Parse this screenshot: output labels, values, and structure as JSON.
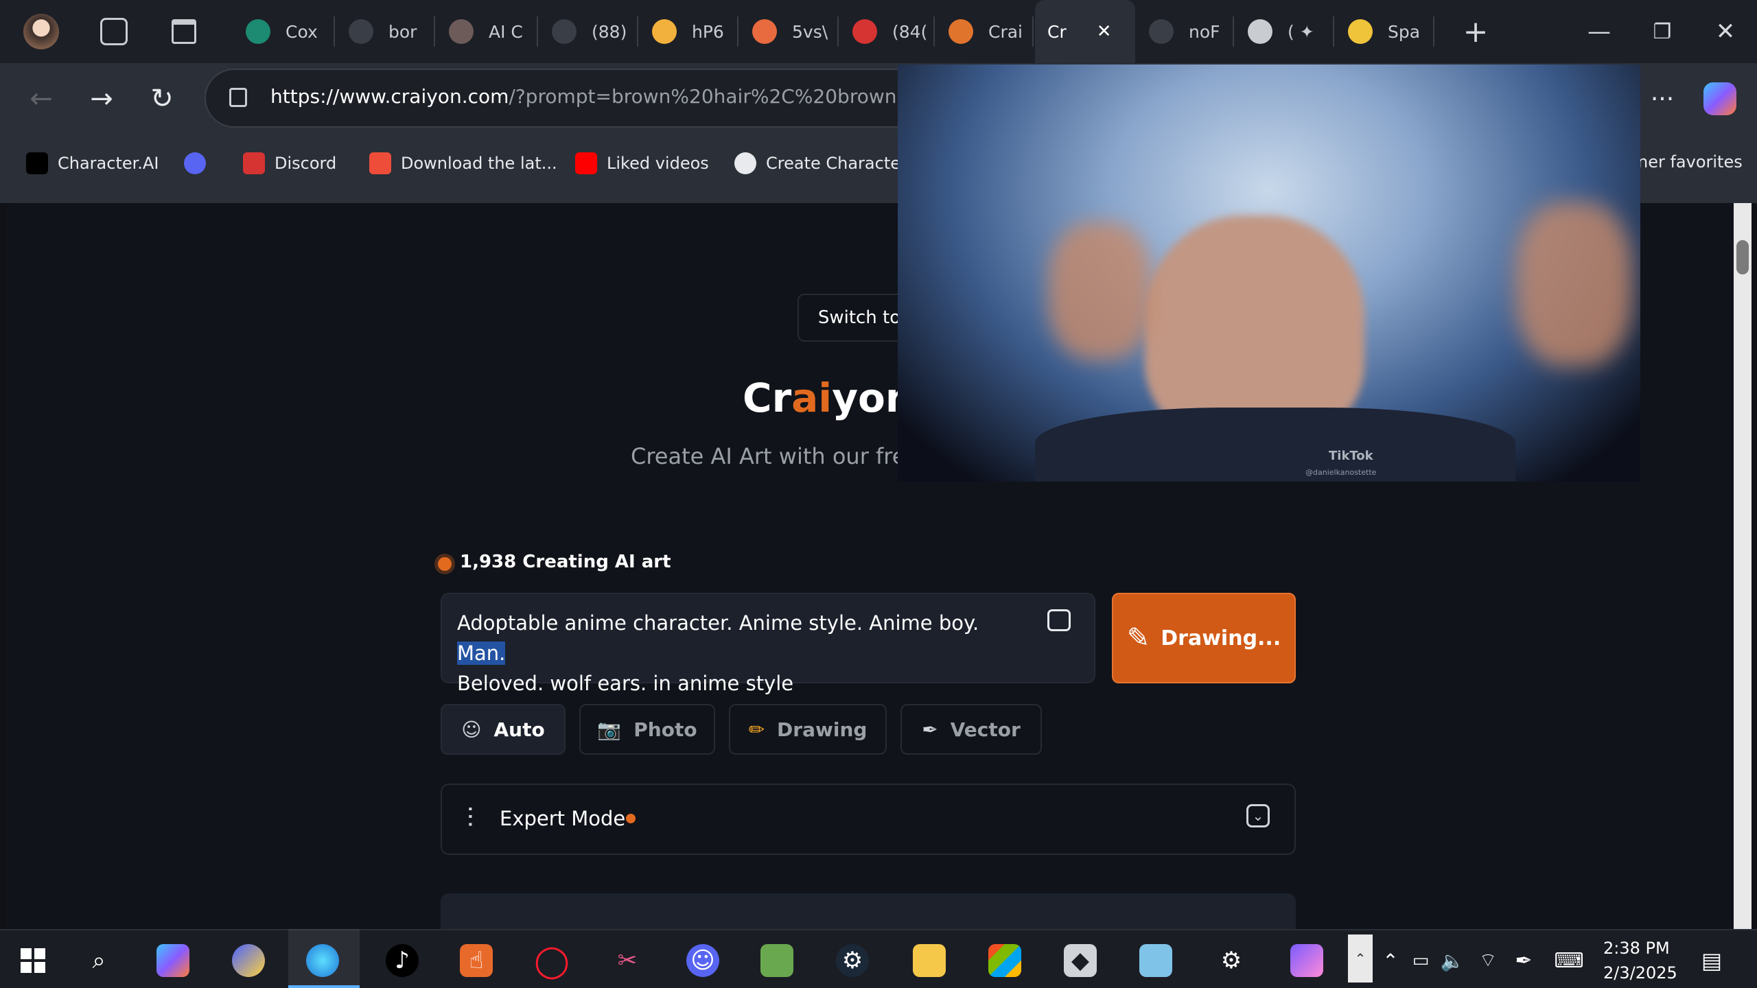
{
  "browser": {
    "tabs": [
      {
        "label": "Cox",
        "color": "#1d8a72"
      },
      {
        "label": "bor",
        "color": "#3a3e47"
      },
      {
        "label": "AI C",
        "color": "#6d5b5a"
      },
      {
        "label": "(88)",
        "color": "#3a3e47"
      },
      {
        "label": "hP6",
        "color": "#f2b13c"
      },
      {
        "label": "5vs\\",
        "color": "#e86a3f"
      },
      {
        "label": "(84(",
        "color": "#d63333"
      },
      {
        "label": "Crai",
        "color": "#e0742d"
      },
      {
        "label": "Cr",
        "color": "#2b2f38"
      },
      {
        "label": "noF",
        "color": "#3a3e47"
      },
      {
        "label": "( ✦",
        "color": "#c9ccd1"
      },
      {
        "label": "Spa",
        "color": "#f0c43a"
      }
    ],
    "url_host": "https://www.craiyon.com",
    "url_path": "/?prompt=brown%20hair%2C%20brown%20eyes",
    "bookmarks": [
      {
        "label": "Character.AI",
        "color": "#000000"
      },
      {
        "label": "",
        "color": "#5865f2"
      },
      {
        "label": "Discord",
        "color": "#d63333"
      },
      {
        "label": "Download the lat...",
        "color": "#ee4d3a"
      },
      {
        "label": "Liked videos",
        "color": "#ff0000"
      },
      {
        "label": "Create Character",
        "color": "#e8eaed"
      }
    ],
    "other_favorites": "ner favorites",
    "icons": [
      "back-icon",
      "forward-icon",
      "refresh-icon",
      "lock-icon",
      "more-icon",
      "copilot-icon",
      "new-tab-icon",
      "close-icon"
    ]
  },
  "page": {
    "switch_label": "Switch to",
    "brand": {
      "pre": "Cr",
      "mid": "ai",
      "post": "yon",
      "accent": "#e26a1f"
    },
    "tagline": "Create AI Art with our free",
    "status_count": "1,938 Creating AI art",
    "prompt_text": "Adoptable anime character. Anime style. Anime boy. ",
    "prompt_highlight": "Man.",
    "prompt_text2": "Beloved. wolf ears. in anime style",
    "draw_button": "Drawing...",
    "styles": [
      {
        "label": "Auto",
        "icon": "☺"
      },
      {
        "label": "Photo",
        "icon": "📷"
      },
      {
        "label": "Drawing",
        "icon": "✏"
      },
      {
        "label": "Vector",
        "icon": "✒"
      }
    ],
    "expert_mode": "Expert Mode"
  },
  "popup": {
    "watermark": "TikTok",
    "handle": "@danielkanostette"
  },
  "taskbar": {
    "time": "2:38 PM",
    "date": "2/3/2025"
  }
}
